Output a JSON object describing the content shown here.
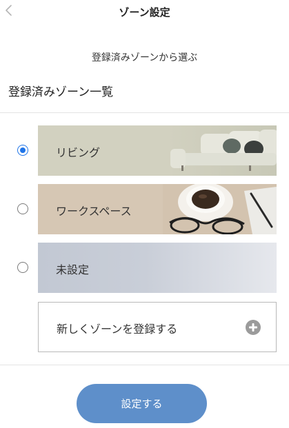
{
  "header": {
    "title": "ゾーン設定",
    "back_icon": "chevron-left-icon"
  },
  "subtitle": "登録済みゾーンから選ぶ",
  "section_title": "登録済みゾーン一覧",
  "zones": [
    {
      "label": "リビング",
      "selected": true,
      "card_color": "#d2d1c0",
      "image": "sofa-image"
    },
    {
      "label": "ワークスペース",
      "selected": false,
      "card_color": "#d6c7b4",
      "image": "coffee-glasses-image"
    },
    {
      "label": "未設定",
      "selected": false,
      "card_color": "#c4cad4",
      "image": "none"
    }
  ],
  "add_zone": {
    "label": "新しくゾーンを登録する",
    "icon": "plus-circle-icon"
  },
  "submit": {
    "label": "設定する"
  },
  "colors": {
    "accent_radio": "#1f74e8",
    "button": "#5e8fca"
  }
}
